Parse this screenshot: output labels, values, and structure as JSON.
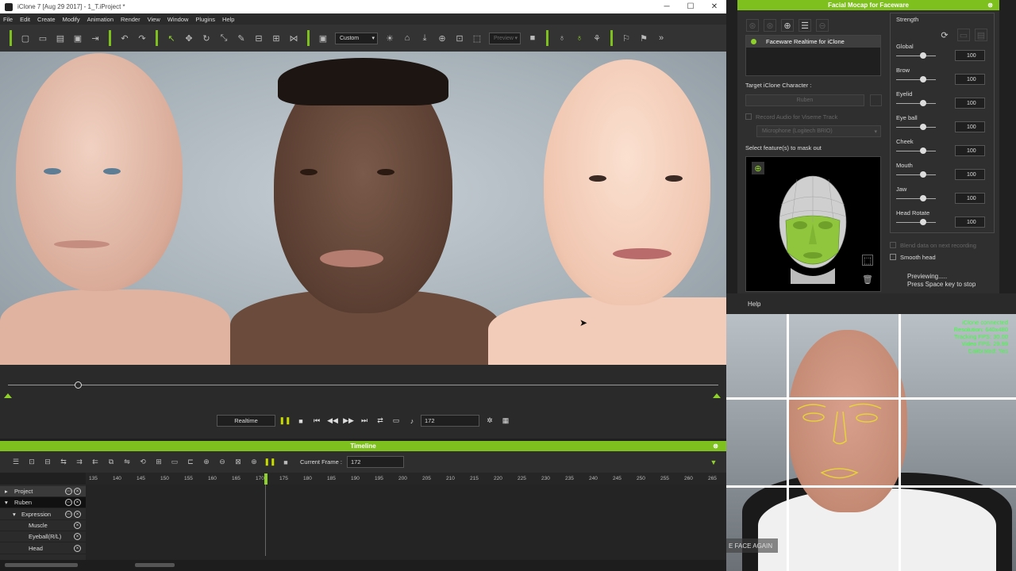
{
  "app": {
    "title": "iClone 7 [Aug 29 2017] - 1_T.iProject *",
    "menu": [
      "File",
      "Edit",
      "Create",
      "Modify",
      "Animation",
      "Render",
      "View",
      "Window",
      "Plugins",
      "Help"
    ],
    "toolbar": {
      "view_combo": "Custom",
      "preview_combo": "Preview"
    }
  },
  "playback": {
    "realtime_label": "Realtime",
    "frame_value": "172"
  },
  "timeline": {
    "title": "Timeline",
    "current_frame_label": "Current Frame :",
    "current_frame_value": "172",
    "ruler_ticks": [
      "135",
      "140",
      "145",
      "150",
      "155",
      "160",
      "165",
      "170",
      "175",
      "180",
      "185",
      "190",
      "195",
      "200",
      "205",
      "210",
      "215",
      "220",
      "225",
      "230",
      "235",
      "240",
      "245",
      "250",
      "255",
      "260",
      "265"
    ],
    "tracks": [
      {
        "label": "Project"
      },
      {
        "label": "Ruben"
      },
      {
        "label": "Expression"
      },
      {
        "label": "Muscle"
      },
      {
        "label": "Eyeball(R/L)"
      },
      {
        "label": "Head"
      }
    ]
  },
  "panel": {
    "title": "Facial Mocap for Faceware",
    "device": "Faceware Realtime for iClone",
    "target_label": "Target iClone Character :",
    "target_value": "Ruben",
    "record_audio_label": "Record Audio for Viseme Track",
    "microphone_value": "Microphone (Logitech BRIO)",
    "mask_label": "Select feature(s) to mask out",
    "strength_title": "Strength",
    "strength": [
      {
        "label": "Global",
        "value": "100"
      },
      {
        "label": "Brow",
        "value": "100"
      },
      {
        "label": "Eyelid",
        "value": "100"
      },
      {
        "label": "Eye ball",
        "value": "100"
      },
      {
        "label": "Cheek",
        "value": "100"
      },
      {
        "label": "Mouth",
        "value": "100"
      },
      {
        "label": "Jaw",
        "value": "100"
      },
      {
        "label": "Head Rotate",
        "value": "100"
      }
    ],
    "blend_label": "Blend data on next recording",
    "smooth_label": "Smooth head",
    "status_line1": "Previewing.....",
    "status_line2": "Press Space key to stop",
    "help_label": "Help"
  },
  "video": {
    "status_lines": [
      "iClone connected",
      "Resolution: 640x480",
      "Tracking FPS: 30.00",
      "Video FPS: 29.99",
      "Calibrated: Yes"
    ],
    "button_text": "E FACE AGAIN"
  },
  "colors": {
    "accent": "#7ec11e",
    "tracker": "#e8d23a",
    "status": "#3cff3c"
  }
}
